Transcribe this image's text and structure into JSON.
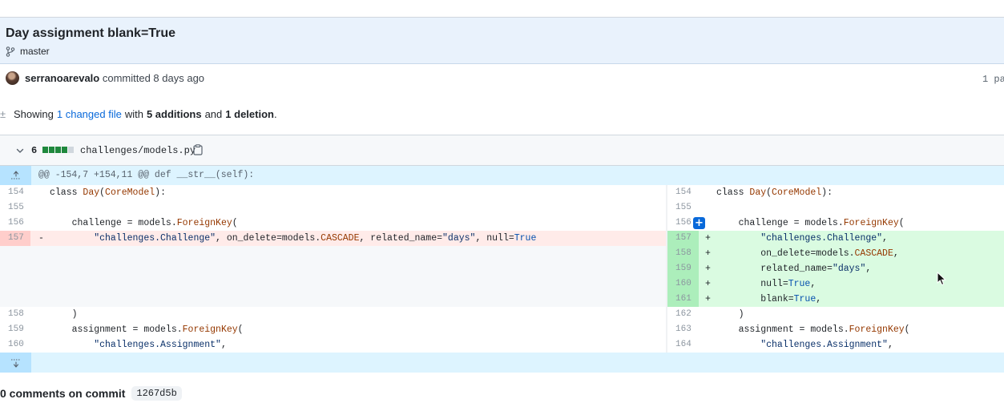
{
  "commit": {
    "title": "Day assignment blank=True",
    "branch": "master",
    "author": "serranoarevalo",
    "action": "committed 8 days ago",
    "parent_label": "1 pa"
  },
  "summary": {
    "prefix": "Showing",
    "changed_files": "1 changed file",
    "with": "with",
    "additions": "5 additions",
    "and": "and",
    "deletions": "1 deletion",
    "suffix": "."
  },
  "file": {
    "change_count": "6",
    "path": "challenges/models.py",
    "diffstat": [
      "add",
      "add",
      "add",
      "add",
      "neutral"
    ]
  },
  "hunk": {
    "header": "@@ -154,7 +154,11 @@ def __str__(self):"
  },
  "left_lines": [
    {
      "num": "154",
      "code": "class Day(CoreModel):"
    },
    {
      "num": "155",
      "code": ""
    },
    {
      "num": "156",
      "code": "    challenge = models.ForeignKey("
    },
    {
      "num": "157",
      "marker": "-",
      "code": "        \"challenges.Challenge\", on_delete=models.CASCADE, related_name=\"days\", null=True"
    },
    {
      "num": "158",
      "code": "    )"
    },
    {
      "num": "159",
      "code": "    assignment = models.ForeignKey("
    },
    {
      "num": "160",
      "code": "        \"challenges.Assignment\","
    }
  ],
  "right_lines": [
    {
      "num": "154",
      "code": "class Day(CoreModel):"
    },
    {
      "num": "155",
      "code": ""
    },
    {
      "num": "156",
      "code": "    challenge = models.ForeignKey("
    },
    {
      "num": "157",
      "marker": "+",
      "code": "        \"challenges.Challenge\","
    },
    {
      "num": "158",
      "marker": "+",
      "code": "        on_delete=models.CASCADE,"
    },
    {
      "num": "159",
      "marker": "+",
      "code": "        related_name=\"days\","
    },
    {
      "num": "160",
      "marker": "+",
      "code": "        null=True,"
    },
    {
      "num": "161",
      "marker": "+",
      "code": "        blank=True,"
    },
    {
      "num": "162",
      "code": "    )"
    },
    {
      "num": "163",
      "code": "    assignment = models.ForeignKey("
    },
    {
      "num": "164",
      "code": "        \"challenges.Assignment\","
    }
  ],
  "add_comment_label": "+",
  "comments": {
    "text": "0 comments on commit",
    "sha": "1267d5b"
  },
  "icons": {
    "branch": "git-branch-icon",
    "summary": "diff-icon",
    "collapse": "chevron-down-icon",
    "copy": "copy-icon",
    "expand_up": "fold-up-icon",
    "expand_down": "fold-down-icon"
  },
  "colors": {
    "addition": "#dafbe1",
    "addition_gutter": "#aceebb",
    "deletion": "#ffebe9",
    "deletion_gutter": "#ffcecb",
    "hunk": "#ddf4ff",
    "link": "#0969da",
    "keyword": "#953800",
    "string": "#0a3069"
  }
}
